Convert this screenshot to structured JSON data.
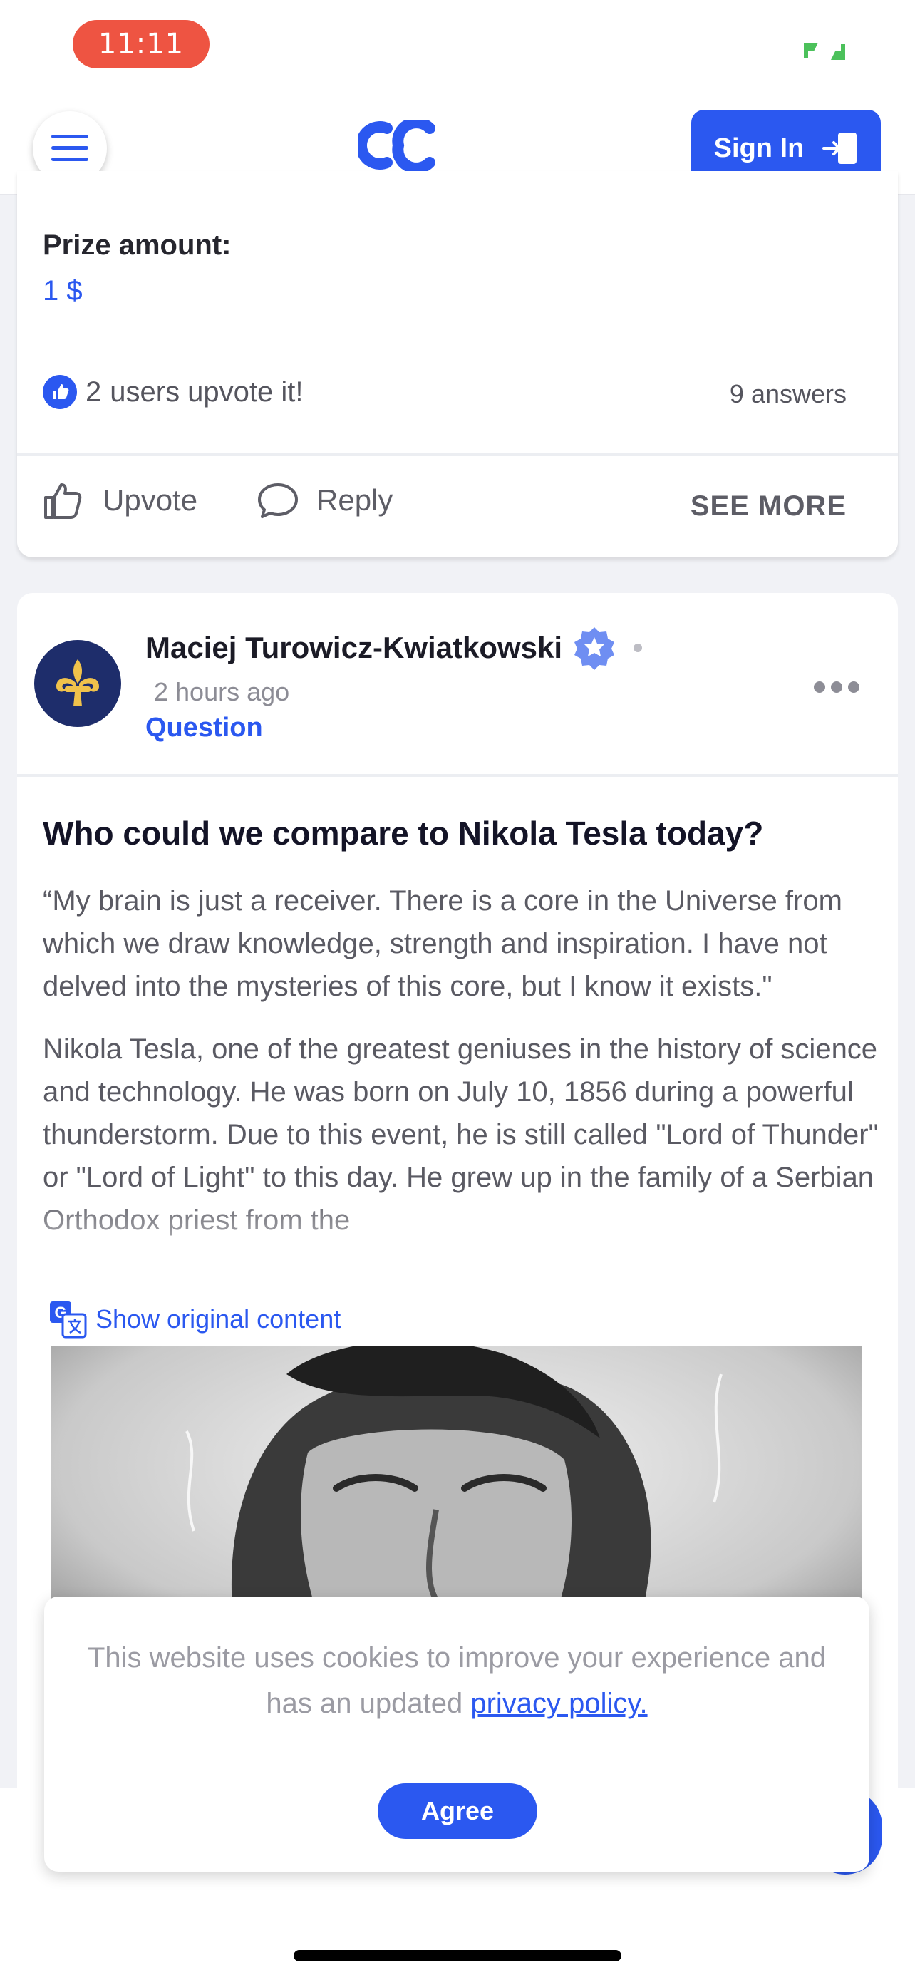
{
  "status_bar": {
    "time": "11:11",
    "accent": "#ee5442",
    "battery_color": "#4cc15b"
  },
  "header": {
    "logo_text": "CC",
    "sign_in_label": "Sign In",
    "brand_color": "#2b58f0"
  },
  "prev_post": {
    "prize_label": "Prize amount:",
    "prize_value": "1 $",
    "upvote_count": "2",
    "upvote_text": "users upvote it!",
    "answers_text": "9 answers",
    "actions": {
      "upvote": "Upvote",
      "reply": "Reply",
      "see_more": "SEE MORE"
    }
  },
  "post": {
    "author": "Maciej Turowicz-Kwiatkowski",
    "time_ago": "2 hours ago",
    "type": "Question",
    "title": "Who could we compare to Nikola Tesla today?",
    "paragraphs": [
      "“My brain is just a receiver. There is a core in the Universe from which we draw knowledge, strength and inspiration. I have not delved into the mysteries of this core, but I know it exists.\"",
      "Nikola Tesla, one of the greatest geniuses in the history of science and technology. He was born on July 10, 1856 during a powerful thunderstorm. Due to this event, he is still called \"Lord of Thunder\" or \"Lord of Light\" to this day. He grew up in the family of a Serbian Orthodox priest from the"
    ],
    "translate_link": "Show original content"
  },
  "cookie": {
    "text_before": "This website uses cookies to improve your experience and has an updated ",
    "link_text": "privacy policy.",
    "agree_label": "Agree"
  }
}
